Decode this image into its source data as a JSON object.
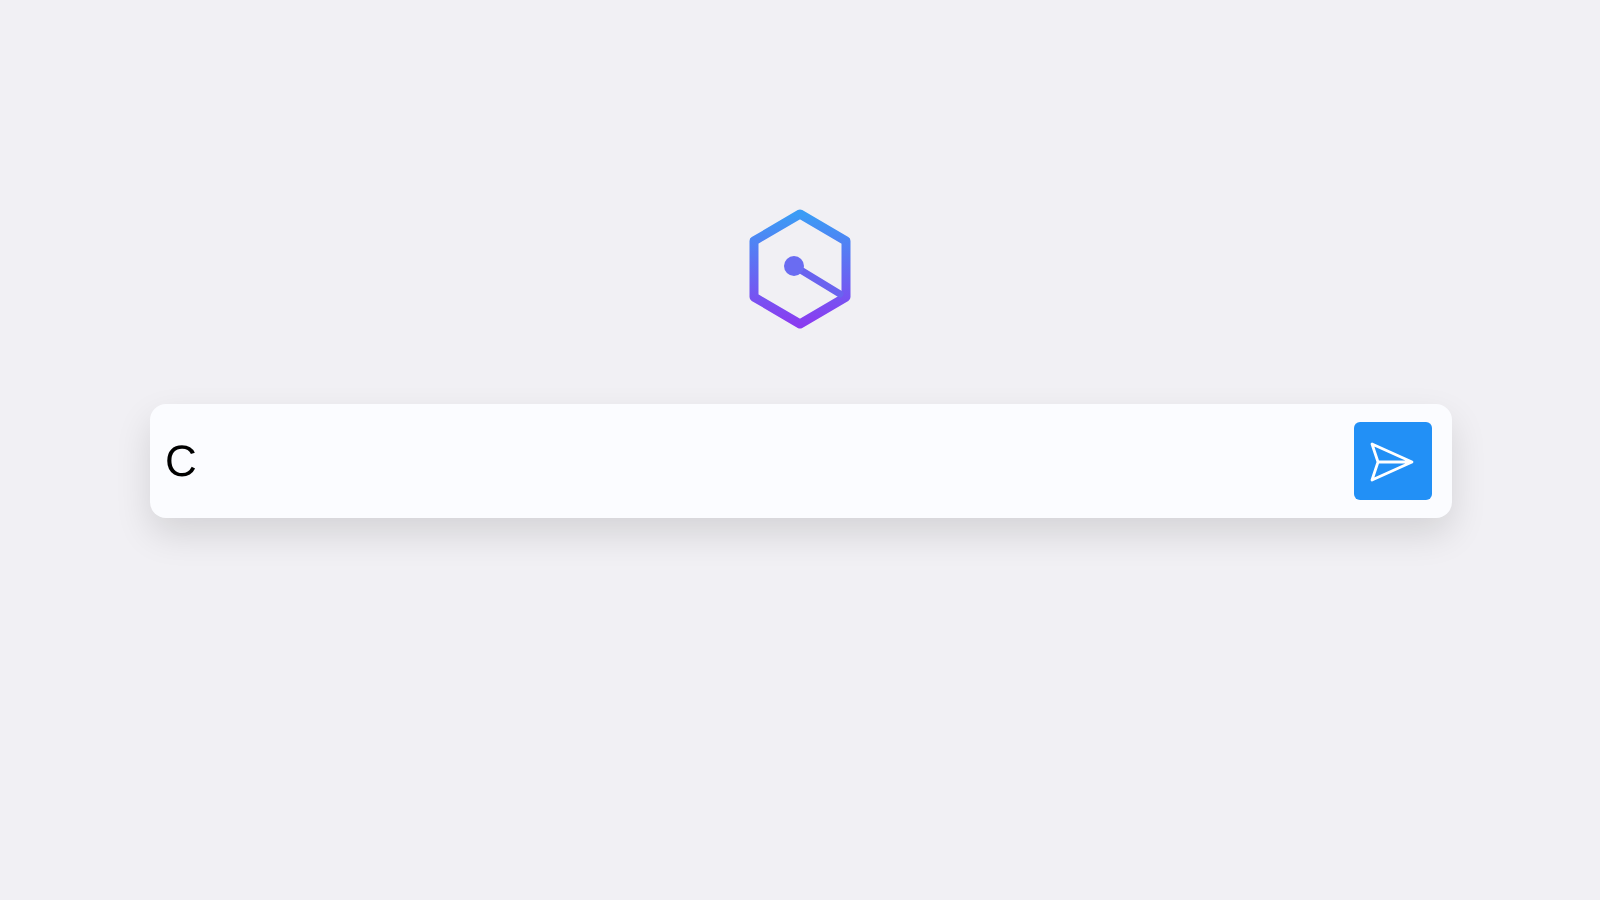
{
  "search": {
    "value": "C"
  }
}
